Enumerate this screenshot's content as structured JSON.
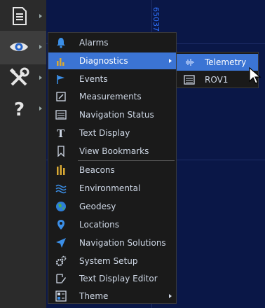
{
  "map": {
    "coordinate_text": "65037"
  },
  "toolbar": {
    "buttons": [
      {
        "name": "document"
      },
      {
        "name": "view"
      },
      {
        "name": "tools"
      },
      {
        "name": "help"
      }
    ]
  },
  "view_menu": {
    "items": [
      {
        "label": "Alarms"
      },
      {
        "label": "Diagnostics"
      },
      {
        "label": "Events"
      },
      {
        "label": "Measurements"
      },
      {
        "label": "Navigation Status"
      },
      {
        "label": "Text Display"
      },
      {
        "label": "View Bookmarks"
      },
      {
        "label": "Beacons"
      },
      {
        "label": "Environmental"
      },
      {
        "label": "Geodesy"
      },
      {
        "label": "Locations"
      },
      {
        "label": "Navigation Solutions"
      },
      {
        "label": "System Setup"
      },
      {
        "label": "Text Display Editor"
      },
      {
        "label": "Theme"
      }
    ]
  },
  "diagnostics_submenu": {
    "items": [
      {
        "label": "Telemetry"
      },
      {
        "label": "ROV1"
      }
    ]
  },
  "colors": {
    "highlight": "#3b74d4",
    "menu_bg": "#1a1a1a",
    "map_bg": "#0a1747",
    "coordinate_text": "#2f73ff"
  }
}
